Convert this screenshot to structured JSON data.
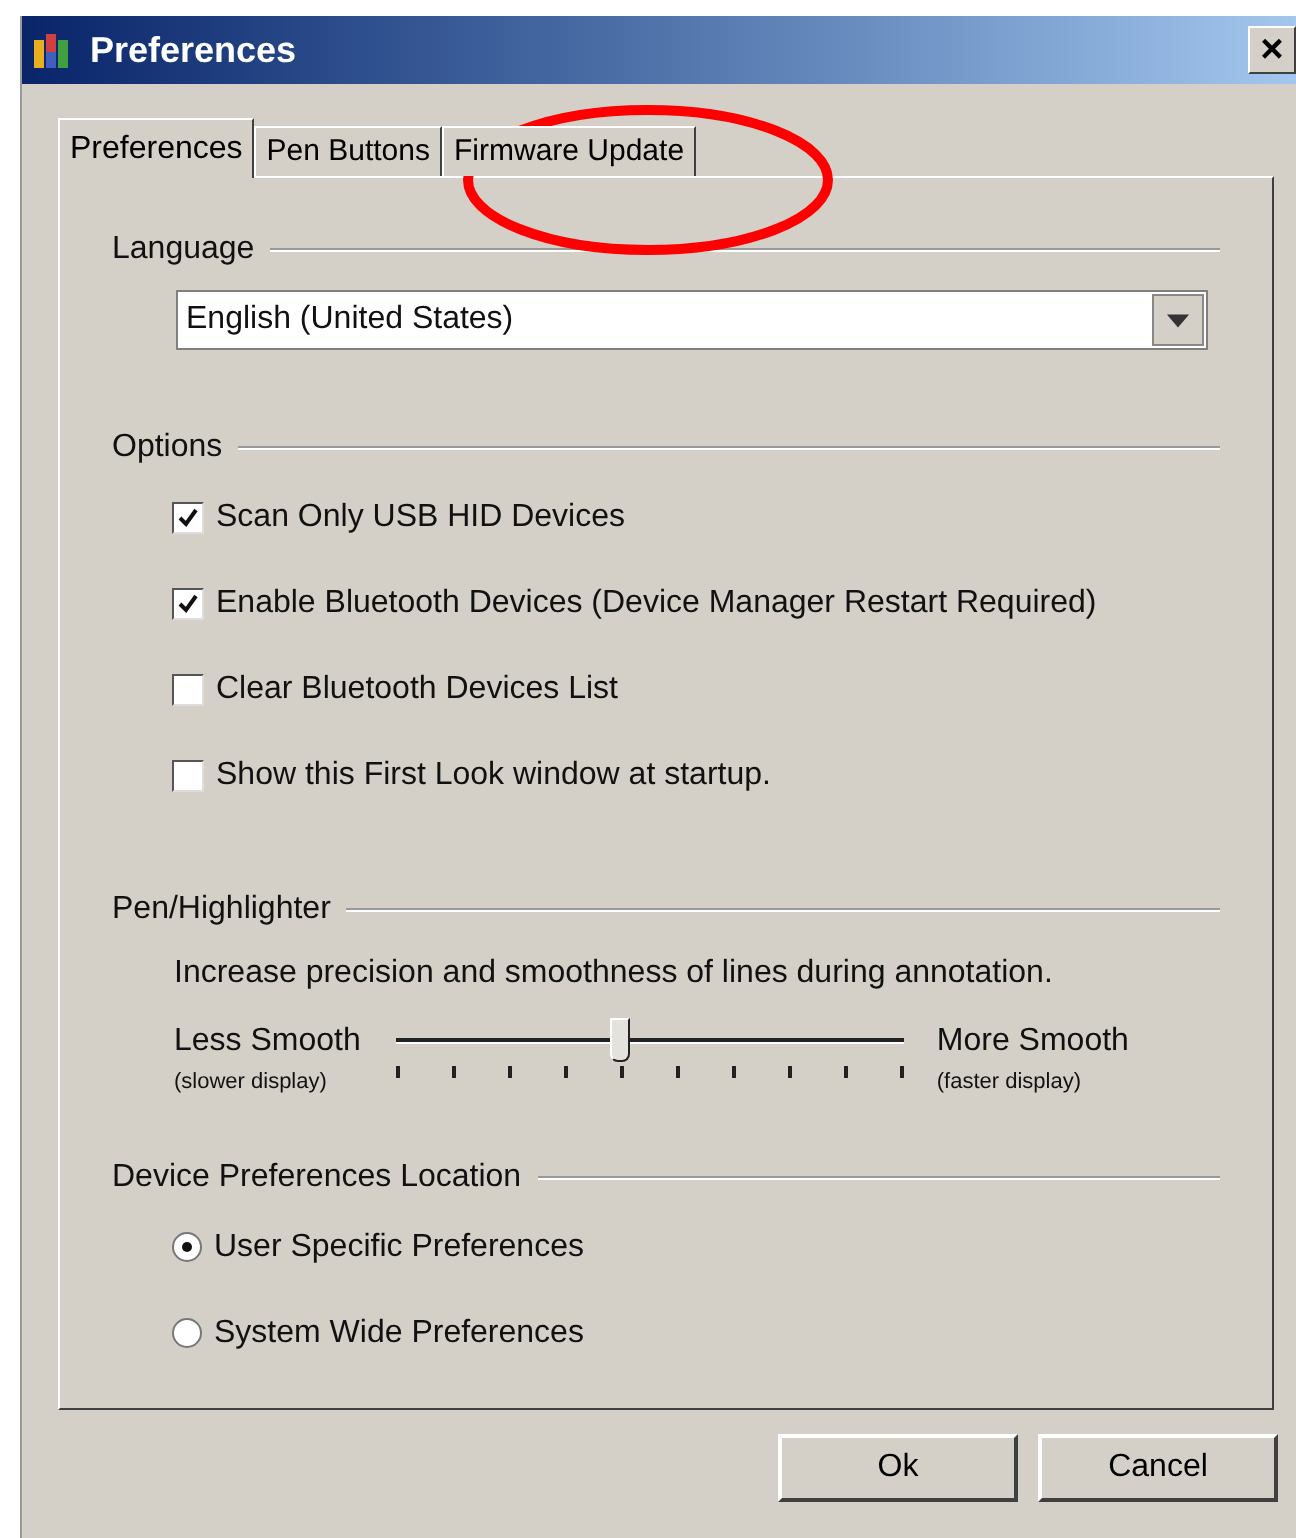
{
  "window": {
    "title": "Preferences",
    "close": "×"
  },
  "tabs": [
    {
      "label": "Preferences",
      "selected": true
    },
    {
      "label": "Pen Buttons",
      "selected": false
    },
    {
      "label": "Firmware Update",
      "selected": false
    }
  ],
  "language": {
    "heading": "Language",
    "value": "English (United States)"
  },
  "options": {
    "heading": "Options",
    "items": [
      {
        "label": "Scan Only USB HID Devices",
        "checked": true
      },
      {
        "label": "Enable Bluetooth Devices (Device Manager Restart Required)",
        "checked": true
      },
      {
        "label": "Clear Bluetooth Devices List",
        "checked": false
      },
      {
        "label": "Show this First Look window at startup.",
        "checked": false
      }
    ]
  },
  "pen": {
    "heading": "Pen/Highlighter",
    "description": "Increase precision and smoothness of lines during annotation.",
    "left_label": "Less Smooth",
    "left_note": "(slower display)",
    "right_label": "More Smooth",
    "right_note": "(faster display)",
    "level": 0.44
  },
  "location": {
    "heading": "Device Preferences Location",
    "items": [
      {
        "label": "User Specific Preferences",
        "selected": true
      },
      {
        "label": "System Wide Preferences",
        "selected": false
      }
    ]
  },
  "buttons": [
    "Ok",
    "Cancel"
  ]
}
